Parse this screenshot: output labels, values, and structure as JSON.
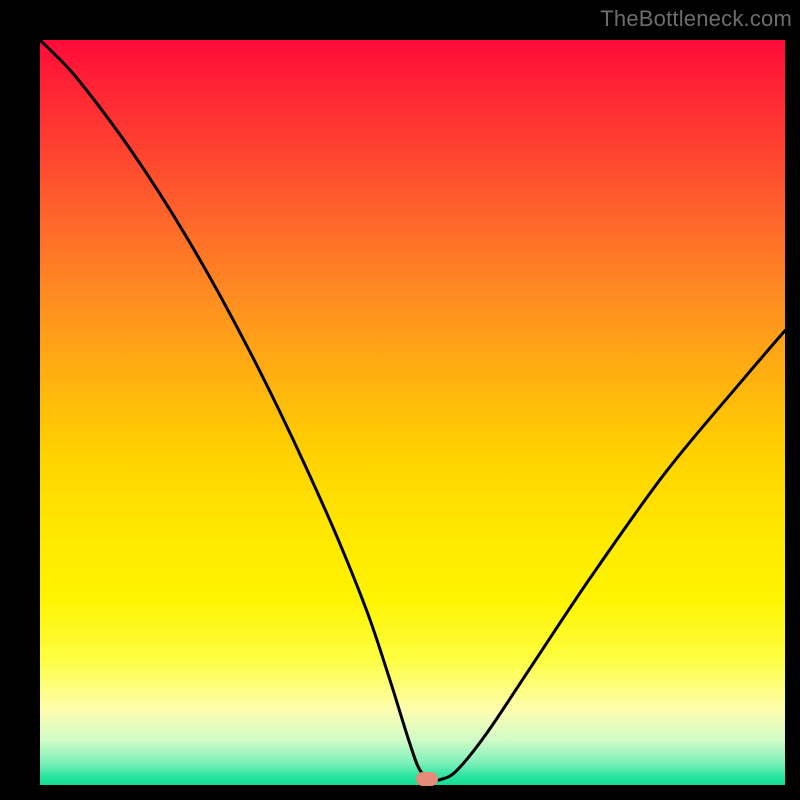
{
  "watermark": {
    "text": "TheBottleneck.com"
  },
  "chart_data": {
    "type": "line",
    "title": "",
    "xlabel": "",
    "ylabel": "",
    "xlim": [
      0,
      100
    ],
    "ylim": [
      0,
      100
    ],
    "grid": false,
    "legend": false,
    "series": [
      {
        "name": "bottleneck-curve",
        "x": [
          0,
          4,
          8,
          12,
          16,
          20,
          24,
          28,
          32,
          36,
          40,
          44,
          47,
          49.5,
          51,
          52.7,
          54,
          56,
          60,
          66,
          74,
          84,
          94,
          100
        ],
        "y": [
          100,
          96,
          91,
          85.5,
          79.5,
          73,
          66,
          58.5,
          50.5,
          42,
          33,
          23,
          14,
          6,
          2,
          0.8,
          0.8,
          2,
          7,
          16,
          28,
          42,
          54,
          61
        ],
        "color": "#000000"
      }
    ],
    "marker": {
      "x": 52,
      "y": 0.8,
      "color": "#e58b7a",
      "shape": "rounded-pill"
    },
    "background_gradient": {
      "direction": "vertical-top-to-bottom",
      "stops": [
        {
          "pct": 0,
          "color": "#ff0a3a"
        },
        {
          "pct": 50,
          "color": "#ffc800"
        },
        {
          "pct": 82,
          "color": "#fefe40"
        },
        {
          "pct": 100,
          "color": "#14dc94"
        }
      ]
    }
  }
}
